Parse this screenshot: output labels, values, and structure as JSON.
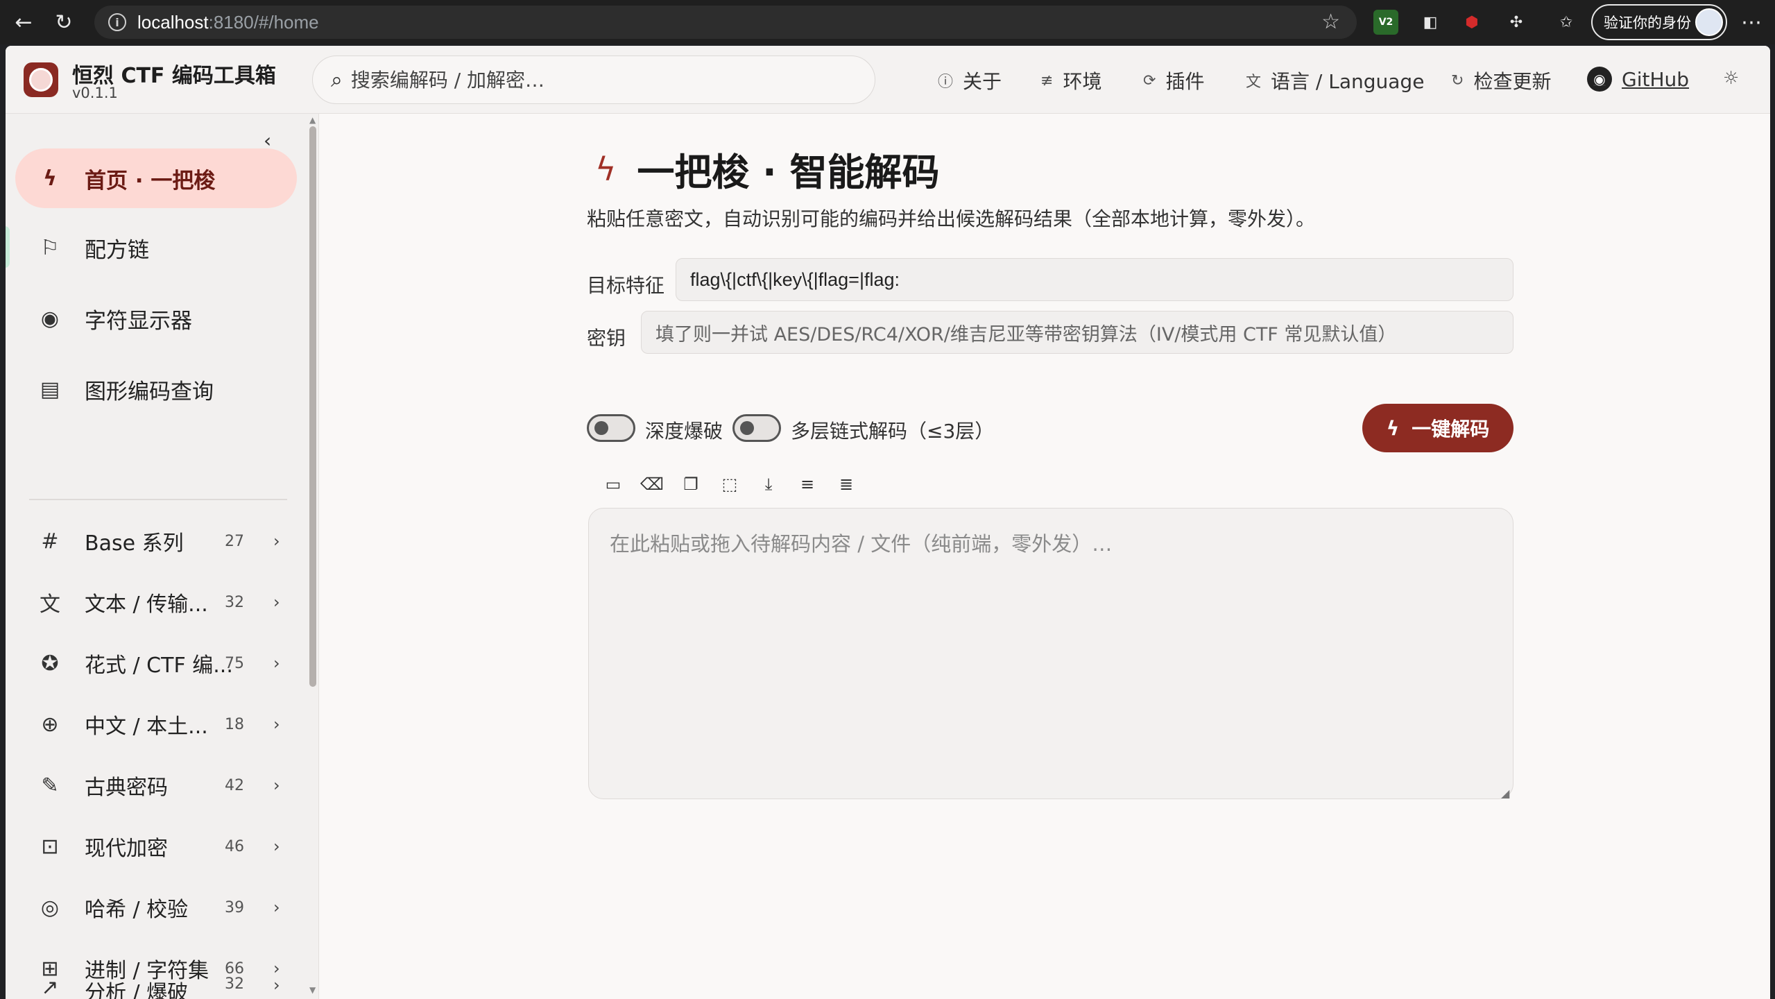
{
  "browser": {
    "url_host": "localhost",
    "url_path": ":8180/#/home",
    "profile_label": "验证你的身份",
    "ext_v2_label": "V2"
  },
  "header": {
    "app_title": "恒烈 CTF 编码工具箱",
    "version": "v0.1.1",
    "search_placeholder": "搜索编解码 / 加解密…",
    "nav": [
      {
        "label": "关于",
        "icon": "info-icon"
      },
      {
        "label": "环境",
        "icon": "sliders-icon"
      },
      {
        "label": "插件",
        "icon": "plugin-icon"
      },
      {
        "label": "语言 / Language",
        "icon": "translate-icon"
      },
      {
        "label": "检查更新",
        "icon": "refresh-icon"
      },
      {
        "label": "GitHub",
        "icon": "github-icon"
      }
    ]
  },
  "sidebar": {
    "primary": [
      {
        "label": "首页 · 一把梭",
        "icon": "bolt-icon",
        "active": true
      },
      {
        "label": "配方链",
        "icon": "flow-icon"
      },
      {
        "label": "字符显示器",
        "icon": "eye-icon"
      },
      {
        "label": "图形编码查询",
        "icon": "book-icon"
      }
    ],
    "categories": [
      {
        "label": "Base 系列",
        "count": "27",
        "icon": "hash-icon"
      },
      {
        "label": "文本 / 传输...",
        "count": "32",
        "icon": "translate-icon"
      },
      {
        "label": "花式 / CTF 编...",
        "count": "75",
        "icon": "star-icon"
      },
      {
        "label": "中文 / 本土...",
        "count": "18",
        "icon": "globe-icon"
      },
      {
        "label": "古典密码",
        "count": "42",
        "icon": "scroll-icon"
      },
      {
        "label": "现代加密",
        "count": "46",
        "icon": "lock-icon"
      },
      {
        "label": "哈希 / 校验",
        "count": "39",
        "icon": "fingerprint-icon"
      },
      {
        "label": "进制 / 字符集",
        "count": "66",
        "icon": "calculator-icon"
      },
      {
        "label": "分析 / 爆破",
        "count": "32",
        "icon": "chart-icon"
      }
    ]
  },
  "main": {
    "title": "一把梭 · 智能解码",
    "description": "粘贴任意密文，自动识别可能的编码并给出候选解码结果（全部本地计算，零外发）。",
    "target_label": "目标特征",
    "target_value": "flag\\{|ctf\\{|key\\{|flag=|flag:",
    "key_label": "密钥",
    "key_placeholder": "填了则一并试 AES/DES/RC4/XOR/维吉尼亚等带密钥算法（IV/模式用 CTF 常见默认值）",
    "toggle_deep": "深度爆破",
    "toggle_chain": "多层链式解码（≤3层）",
    "decode_button": "一键解码",
    "input_placeholder": "在此粘贴或拖入待解码内容 / 文件（纯前端，零外发）…"
  }
}
